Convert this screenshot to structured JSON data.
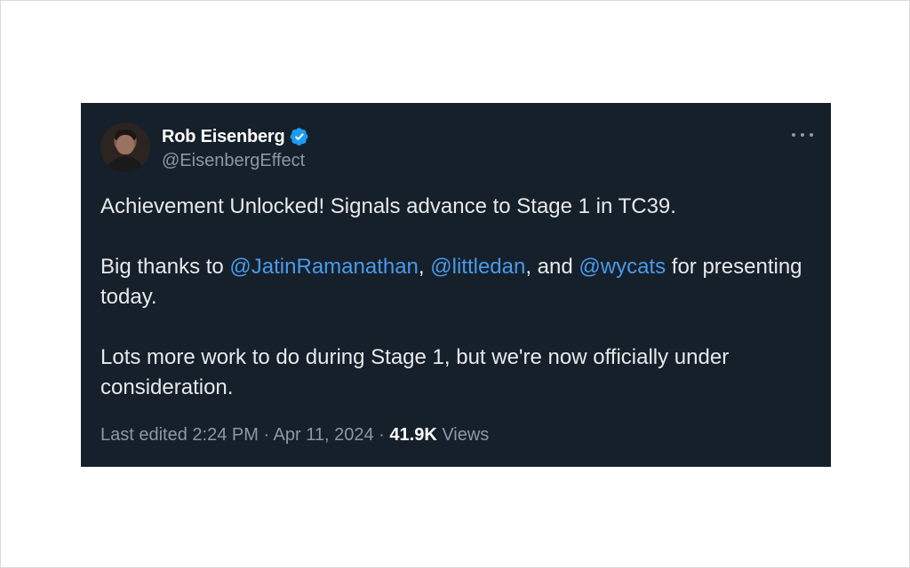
{
  "tweet": {
    "author": {
      "display_name": "Rob Eisenberg",
      "handle": "@EisenbergEffect",
      "verified": true
    },
    "more_label": "More",
    "text": {
      "line1": "Achievement Unlocked! Signals advance to Stage 1 in TC39.",
      "p2_prefix": "Big thanks to ",
      "mention1": "@JatinRamanathan",
      "sep1": ", ",
      "mention2": "@littledan",
      "sep2": ", and ",
      "mention3": "@wycats",
      "p2_suffix": " for presenting today.",
      "p3": "Lots more work to do during Stage 1, but we're now officially under consideration."
    },
    "meta": {
      "edited": "Last edited 2:24 PM · Apr 11, 2024 · ",
      "views_count": "41.9K",
      "views_label": " Views"
    }
  },
  "colors": {
    "card_bg": "#15202b",
    "mention": "#4a99e9",
    "verified": "#1d9bf0",
    "secondary_text": "#8b98a5"
  },
  "icons": {
    "verified": "verified-badge-icon",
    "more": "more-dots-icon"
  }
}
